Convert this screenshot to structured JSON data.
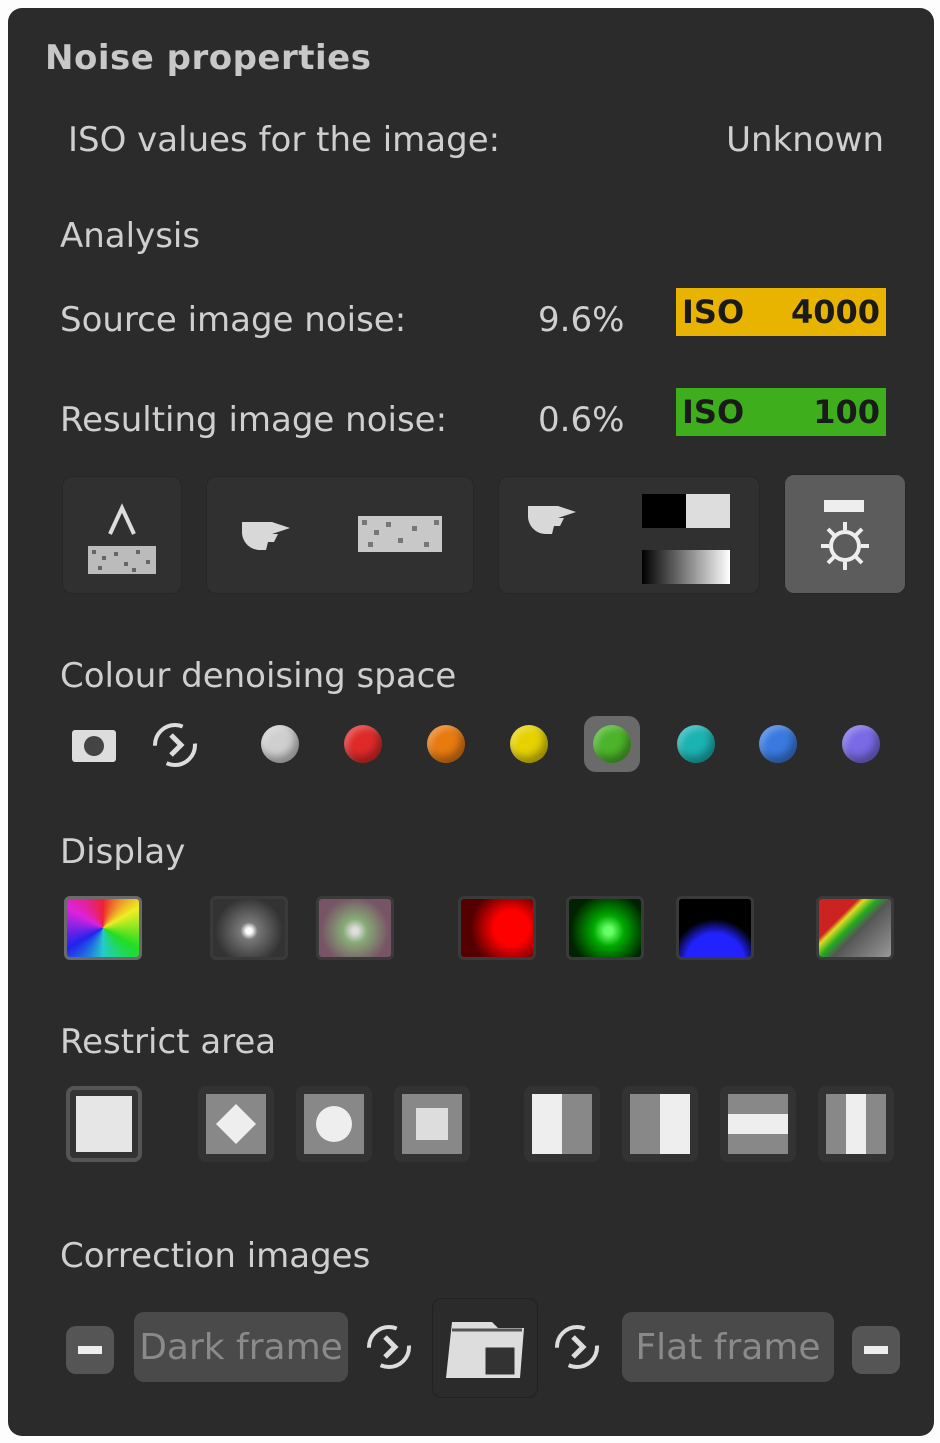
{
  "panel": {
    "title": "Noise properties",
    "iso_label": "ISO values for the image:",
    "iso_value": "Unknown"
  },
  "analysis": {
    "heading": "Analysis",
    "source": {
      "label": "Source image noise:",
      "percent": "9.6%",
      "iso_word": "ISO",
      "iso_value": "4000",
      "color": "#e8b400"
    },
    "result": {
      "label": "Resulting image noise:",
      "percent": "0.6%",
      "iso_word": "ISO",
      "iso_value": "100",
      "color": "#3fae1c"
    }
  },
  "tools": [
    {
      "icon": "auto-measure-icon",
      "active": false
    },
    {
      "icon": "pick-noise-pattern-icon",
      "active": false
    },
    {
      "icon": "pick-tonal-range-icon",
      "active": false
    },
    {
      "icon": "settings-gear-icon",
      "active": true
    }
  ],
  "colour_space": {
    "heading": "Colour denoising space",
    "colors": [
      "#cfcfcf",
      "#e02a2a",
      "#e87a10",
      "#e6d200",
      "#4cb32a",
      "#1cb3b3",
      "#3a7ae0",
      "#7a6ae6"
    ],
    "selected_index": 4
  },
  "display": {
    "heading": "Display",
    "modes": [
      "full-color-icon",
      "luminance-icon",
      "chroma-icon",
      "red-channel-icon",
      "green-channel-icon",
      "blue-channel-icon",
      "split-view-icon"
    ],
    "selected_index": 0
  },
  "restrict": {
    "heading": "Restrict area",
    "shapes": [
      "full-area-icon",
      "diamond-area-icon",
      "circle-area-icon",
      "square-area-icon",
      "left-half-icon",
      "right-half-icon",
      "middle-band-icon",
      "vertical-band-icon"
    ],
    "selected_index": 0
  },
  "correction": {
    "heading": "Correction images",
    "dark_frame": "Dark frame",
    "flat_frame": "Flat frame"
  }
}
